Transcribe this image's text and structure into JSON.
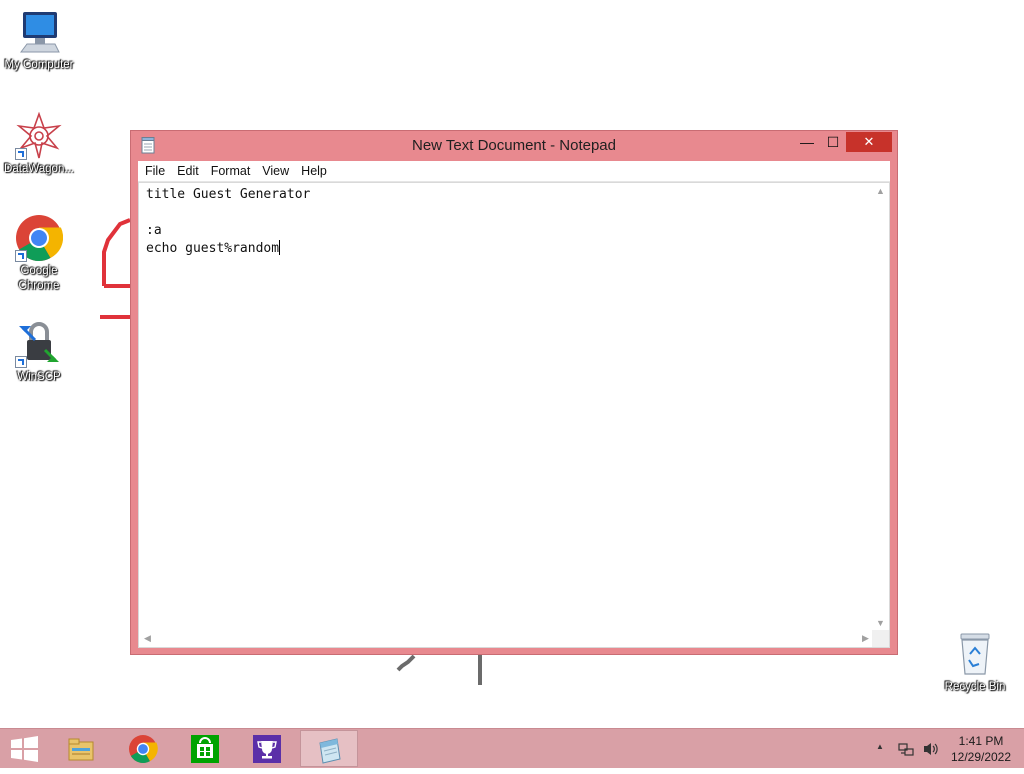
{
  "desktop": {
    "icons": [
      {
        "label": "My Computer",
        "icon": "computer-icon"
      },
      {
        "label": "DataWagon...",
        "icon": "datawagon-icon"
      },
      {
        "label": "Google Chrome",
        "icon": "chrome-icon"
      },
      {
        "label": "WinSCP",
        "icon": "winscp-icon"
      },
      {
        "label": "Recycle Bin",
        "icon": "recycle-bin-icon"
      }
    ]
  },
  "window": {
    "title": "New Text Document - Notepad",
    "buttons": {
      "minimize": "—",
      "maximize": "☐",
      "close": "✕"
    },
    "menu": [
      "File",
      "Edit",
      "Format",
      "View",
      "Help"
    ],
    "content_lines": [
      "title Guest Generator",
      "",
      ":a",
      "echo guest%random"
    ],
    "accent_color": "#e8898f",
    "close_color": "#c7322a"
  },
  "taskbar": {
    "apps": [
      {
        "name": "file-explorer",
        "icon": "folder-icon"
      },
      {
        "name": "google-chrome",
        "icon": "chrome-icon"
      },
      {
        "name": "store",
        "icon": "store-icon"
      },
      {
        "name": "trophy-app",
        "icon": "trophy-icon"
      },
      {
        "name": "notepad",
        "icon": "notepad-icon",
        "active": true
      }
    ],
    "tray": {
      "show_hidden": "▲",
      "time": "1:41 PM",
      "date": "12/29/2022"
    },
    "color": "#d9a0a6"
  }
}
